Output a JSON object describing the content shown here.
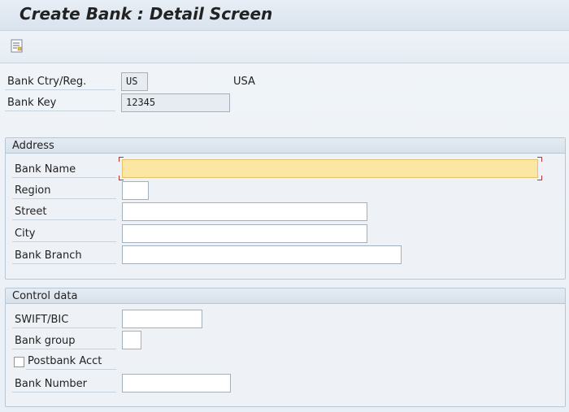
{
  "title": "Create Bank : Detail Screen",
  "toolbar": {
    "details_icon": "details-icon"
  },
  "header": {
    "bank_ctry_label": "Bank Ctry/Reg.",
    "bank_ctry_value": "US",
    "bank_ctry_desc": "USA",
    "bank_key_label": "Bank Key",
    "bank_key_value": "12345"
  },
  "address": {
    "title": "Address",
    "bank_name_label": "Bank Name",
    "bank_name_value": "",
    "region_label": "Region",
    "region_value": "",
    "street_label": "Street",
    "street_value": "",
    "city_label": "City",
    "city_value": "",
    "bank_branch_label": "Bank Branch",
    "bank_branch_value": ""
  },
  "control": {
    "title": "Control data",
    "swift_label": "SWIFT/BIC",
    "swift_value": "",
    "bank_group_label": "Bank group",
    "bank_group_value": "",
    "postbank_label": "Postbank Acct",
    "postbank_checked": false,
    "bank_number_label": "Bank Number",
    "bank_number_value": ""
  }
}
